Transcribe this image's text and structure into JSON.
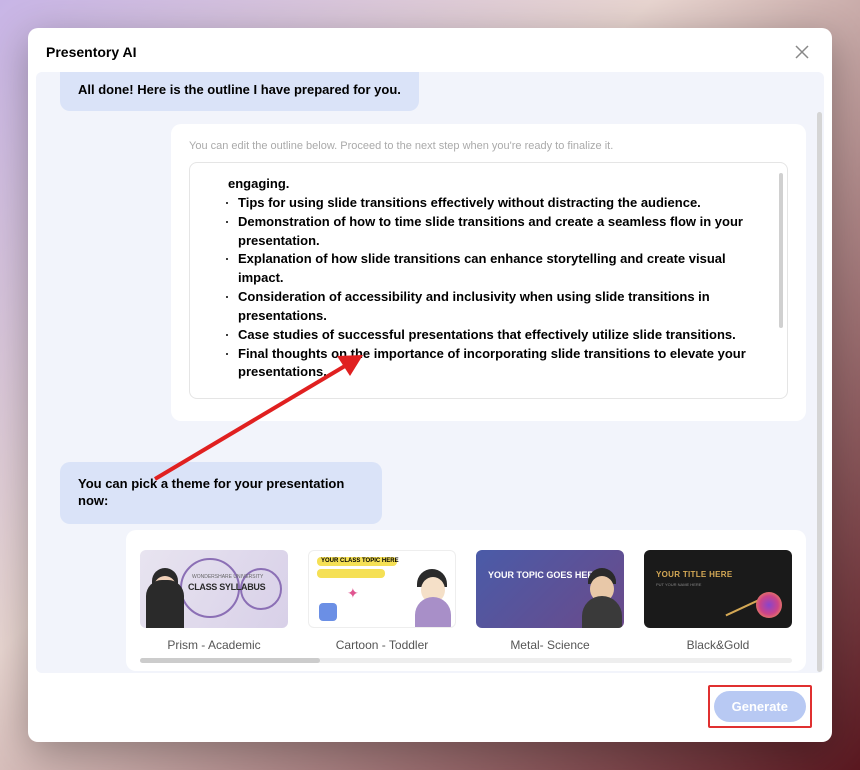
{
  "modal": {
    "title": "Presentory AI",
    "outline_done": "All done! Here is the outline I have prepared for you.",
    "outline_hint": "You can edit the outline below. Proceed to the next step when you're ready to finalize it.",
    "outline_items": [
      "engaging.",
      "Tips for using slide transitions effectively without distracting the audience.",
      "Demonstration of how to time slide transitions and create a seamless flow in your presentation.",
      "Explanation of how slide transitions can enhance storytelling and create visual impact.",
      "Consideration of accessibility and inclusivity when using slide transitions in presentations.",
      "Case studies of successful presentations that effectively utilize slide transitions.",
      "Final thoughts on the importance of incorporating slide transitions to elevate your presentations."
    ],
    "pick_theme": "You can pick a theme for your presentation now:",
    "themes": [
      {
        "label": "Prism - Academic",
        "thumb_title": "CLASS SYLLABUS",
        "thumb_sub": "WONDERSHARE UNIVERSITY"
      },
      {
        "label": "Cartoon - Toddler",
        "thumb_title": "YOUR CLASS TOPIC HERE"
      },
      {
        "label": "Metal- Science",
        "thumb_title": "YOUR TOPIC GOES HERE"
      },
      {
        "label": "Black&Gold",
        "thumb_title": "YOUR TITLE HERE",
        "thumb_sub": "PUT YOUR NAME HERE"
      }
    ],
    "generate_label": "Generate"
  },
  "annotation": {
    "arrow_color": "#e02020",
    "highlight_color": "#e03030"
  }
}
